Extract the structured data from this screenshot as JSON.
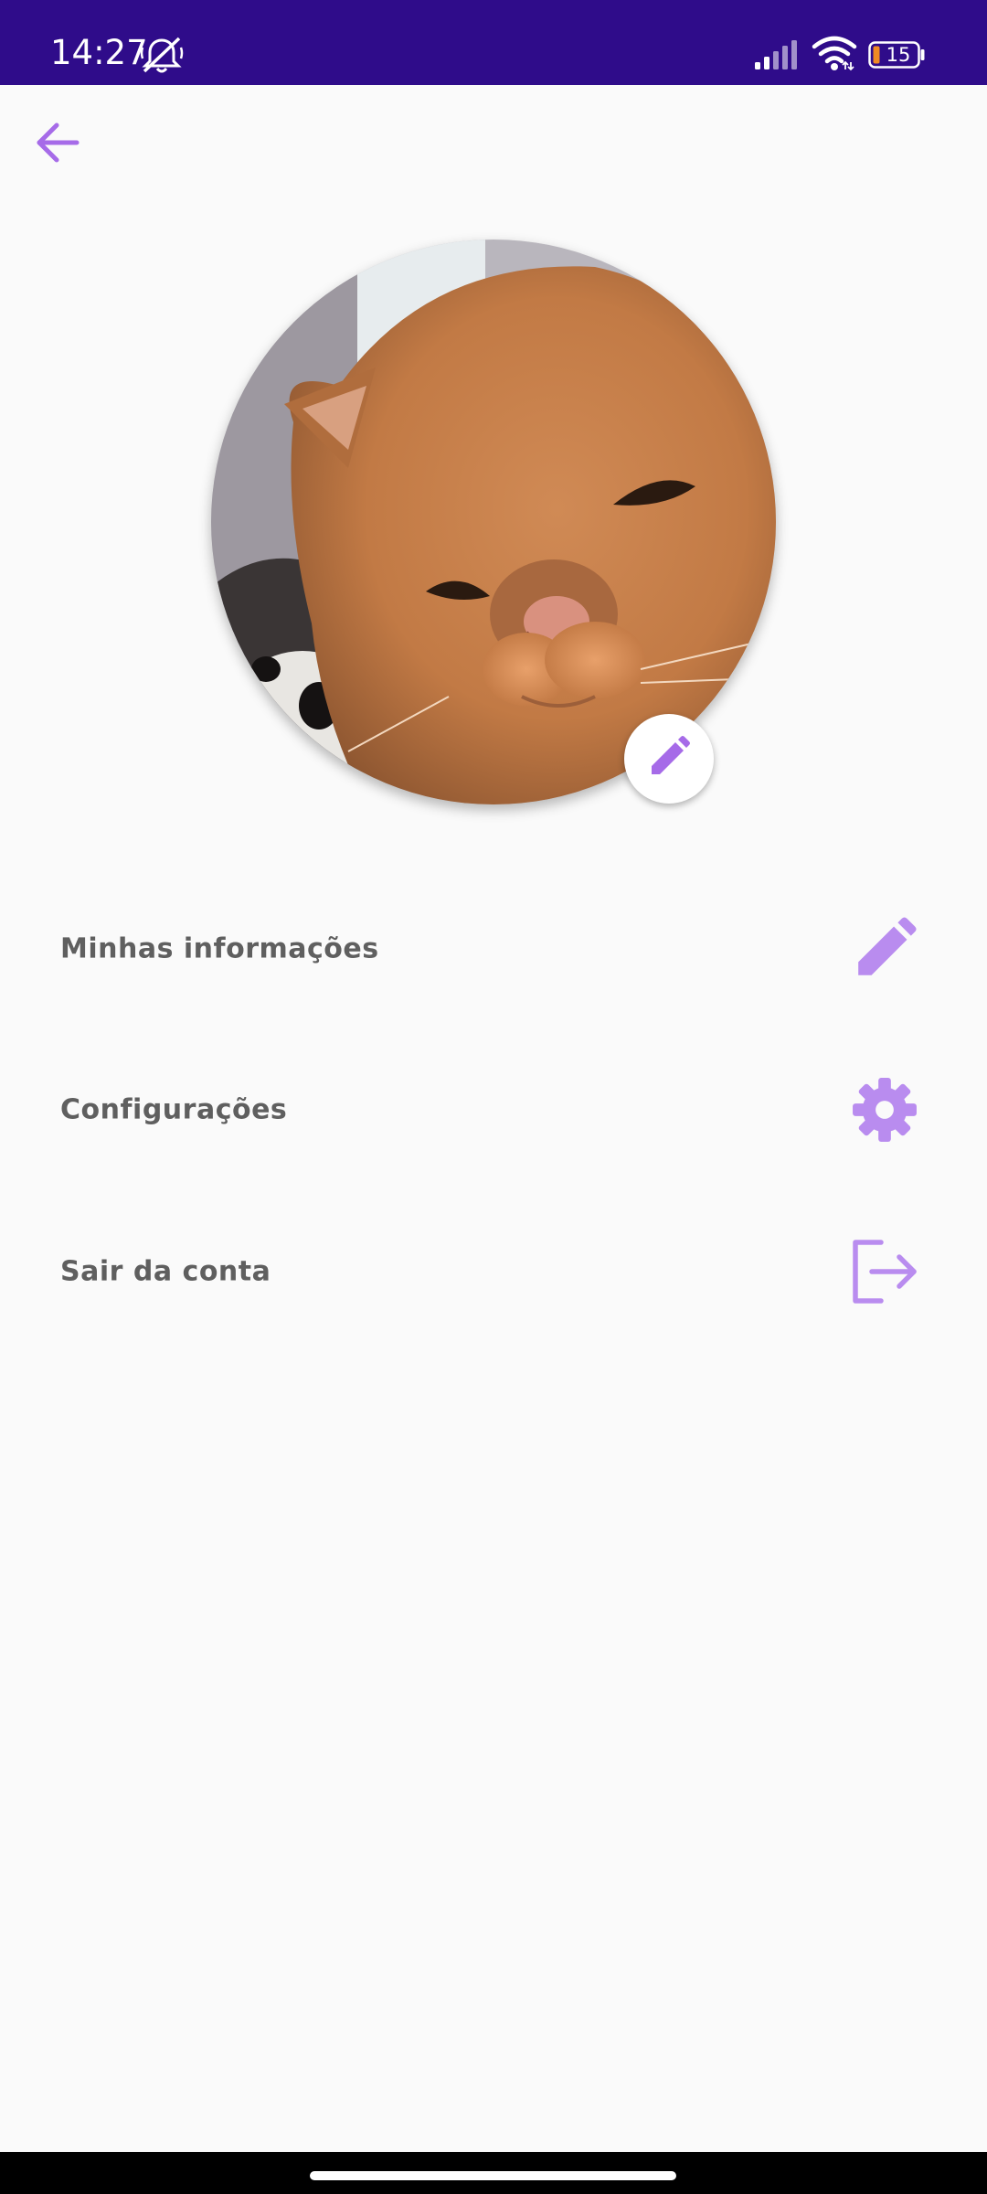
{
  "status_bar": {
    "time": "14:27",
    "battery_level": "15",
    "icons": [
      "bell-off-icon",
      "signal-icon",
      "wifi-icon",
      "battery-icon"
    ]
  },
  "header": {
    "back_icon": "arrow-left-icon"
  },
  "profile": {
    "avatar_description": "cat-photo",
    "edit_icon": "pencil-icon"
  },
  "menu": {
    "items": [
      {
        "label": "Minhas informações",
        "icon": "pencil-icon"
      },
      {
        "label": "Configurações",
        "icon": "gear-icon"
      },
      {
        "label": "Sair da conta",
        "icon": "logout-icon"
      }
    ]
  },
  "colors": {
    "status_bar_bg": "#2f0c8a",
    "accent": "#a66be8",
    "accent_light": "#b98cef",
    "page_bg": "#fafafa",
    "text": "#5f5f5f"
  }
}
